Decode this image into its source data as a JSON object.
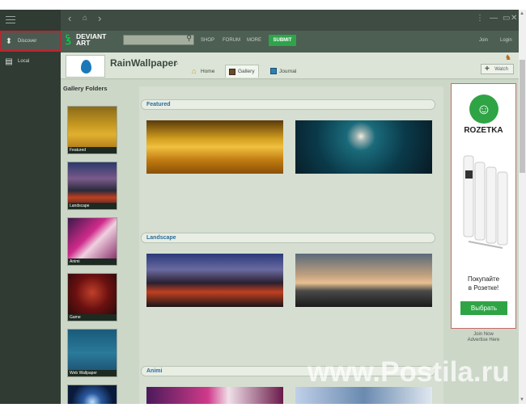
{
  "sidebar": {
    "items": [
      {
        "label": "Discover",
        "icon": "deviantart-icon"
      },
      {
        "label": "Local",
        "icon": "local-folder-icon"
      }
    ]
  },
  "titlebar": {
    "back": "‹",
    "forward": "›",
    "home": "⌂",
    "more": "⋮",
    "minimize": "—",
    "maximize": "▭",
    "close": "✕"
  },
  "deviantart": {
    "logo_line1": "DEVIANT",
    "logo_line2": "ART",
    "nav": [
      "SHOP",
      "FORUM",
      "MORE"
    ],
    "submit": "SUBMIT",
    "join": "Join",
    "login": "Login",
    "accent": "#05cc47"
  },
  "profile": {
    "username": "RainWallpaper",
    "tabs": [
      "Home",
      "Gallery",
      "Journal"
    ],
    "active_tab": "Gallery",
    "watch": "Watch"
  },
  "gallery_folders": {
    "title": "Gallery Folders",
    "folders": [
      "Featured",
      "Landscape",
      "Animi",
      "Game",
      "Web Wallpaper"
    ]
  },
  "sections": [
    "Featured",
    "Landscape",
    "Animi"
  ],
  "ad": {
    "brand": "ROZETKA",
    "text_line1": "Покупайте",
    "text_line2": "в Розетке!",
    "button": "Выбрать",
    "join_now": "Join Now",
    "advertise": "Advertise Here"
  },
  "watermark": "www.Postila.ru"
}
